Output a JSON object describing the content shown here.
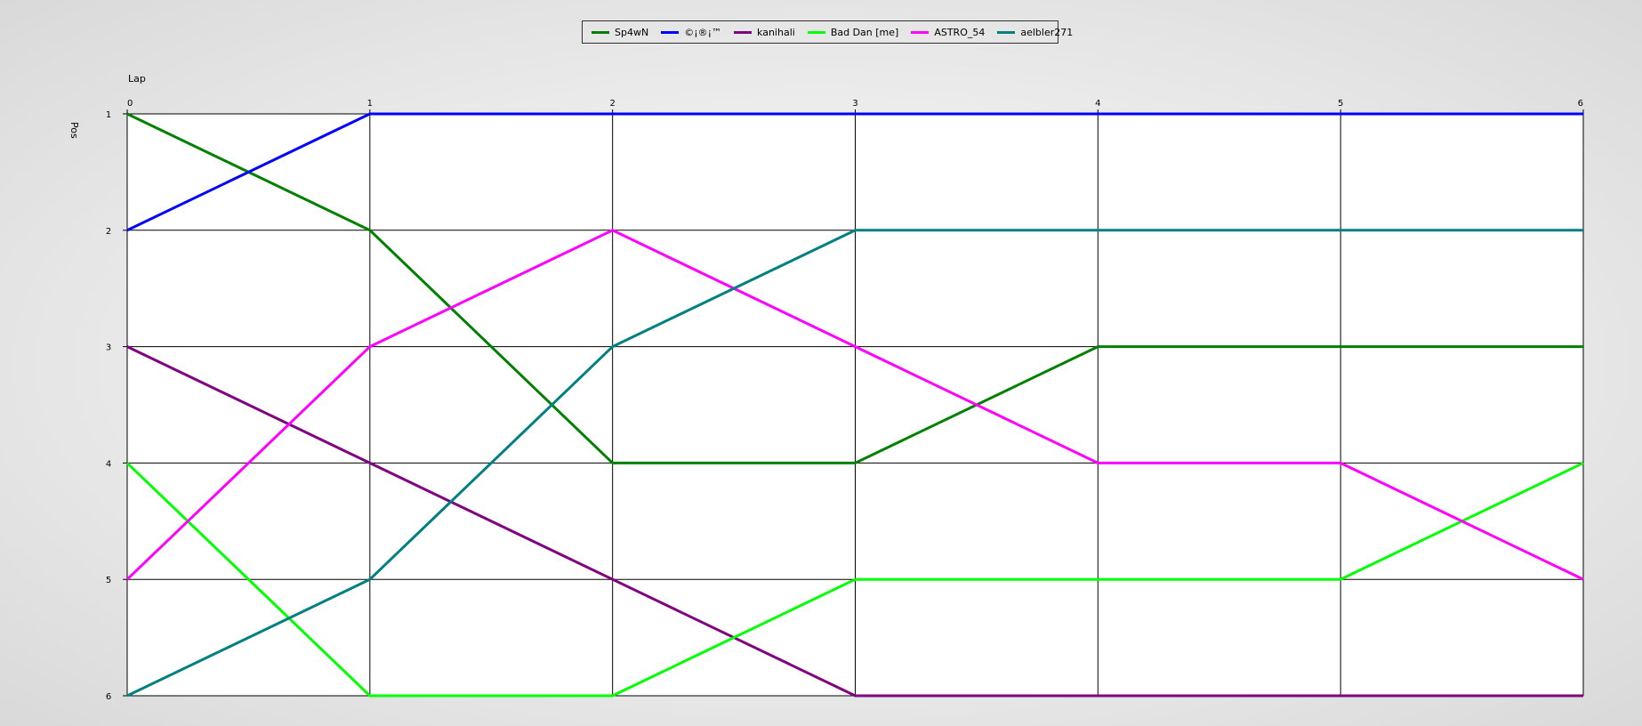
{
  "chart_data": {
    "type": "line",
    "xlabel": "Lap",
    "ylabel": "Pos",
    "x": [
      0,
      1,
      2,
      3,
      4,
      5,
      6
    ],
    "xlim": [
      0,
      6
    ],
    "ylim": [
      1,
      6
    ],
    "y_inverted": true,
    "y_ticks": [
      1,
      2,
      3,
      4,
      5,
      6
    ],
    "grid": true,
    "legend_position": "top-center",
    "series": [
      {
        "name": "Sp4wN",
        "color": "#008000",
        "values": [
          1,
          2,
          4,
          4,
          3,
          3,
          3
        ]
      },
      {
        "name": "©¡®¡™",
        "color": "#0000ff",
        "values": [
          2,
          1,
          1,
          1,
          1,
          1,
          1
        ]
      },
      {
        "name": "kanihali",
        "color": "#800080",
        "values": [
          3,
          4,
          5,
          6,
          6,
          6,
          6
        ]
      },
      {
        "name": "Bad Dan [me]",
        "color": "#00ff00",
        "values": [
          4,
          6,
          6,
          5,
          5,
          5,
          4
        ]
      },
      {
        "name": "ASTRO_54",
        "color": "#ff00ff",
        "values": [
          5,
          3,
          2,
          3,
          4,
          4,
          5
        ]
      },
      {
        "name": "aelbler271",
        "color": "#008080",
        "values": [
          6,
          5,
          3,
          2,
          2,
          2,
          2
        ]
      }
    ]
  }
}
